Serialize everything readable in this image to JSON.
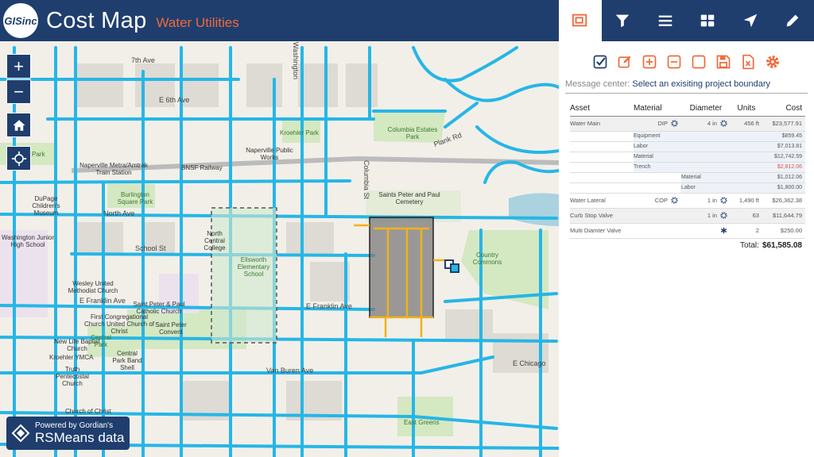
{
  "header": {
    "logo_text": "GISinc",
    "title": "Cost Map",
    "subtitle": "Water Utilities"
  },
  "tabs": [
    {
      "icon": "project-boundary-icon",
      "active": true
    },
    {
      "icon": "filter-icon"
    },
    {
      "icon": "list-icon"
    },
    {
      "icon": "grid-icon"
    },
    {
      "icon": "navigate-icon"
    },
    {
      "icon": "edit-icon"
    }
  ],
  "toolbar": [
    "check-icon",
    "edit-icon",
    "add-icon",
    "remove-icon",
    "square-icon",
    "save-icon",
    "excel-icon",
    "settings-icon"
  ],
  "message": {
    "label": "Message center:",
    "text": "Select an exisiting project boundary"
  },
  "table": {
    "headers": [
      "Asset",
      "Material",
      "Diameter",
      "Units",
      "Cost"
    ],
    "rows": [
      {
        "asset": "Water Main",
        "material": "DIP",
        "diameter": "4 in",
        "units": "456 ft",
        "cost": "$23,577.91"
      },
      {
        "asset": "Water Lateral",
        "material": "COP",
        "diameter": "1 in",
        "units": "1,490 ft",
        "cost": "$26,362.38"
      },
      {
        "asset": "Curb Stop Valve",
        "material": "",
        "diameter": "1 in",
        "units": "63",
        "cost": "$11,644.79"
      },
      {
        "asset": "Multi Diamter Valve",
        "material": "",
        "diameter": "",
        "units": "2",
        "cost": "$250.00"
      }
    ],
    "breakdown": [
      {
        "label": "Equipment",
        "cost": "$859.45"
      },
      {
        "label": "Labor",
        "cost": "$7,013.81"
      },
      {
        "label": "Material",
        "cost": "$12,742.59"
      },
      {
        "label": "Trench",
        "cost": "$2,812.06"
      }
    ],
    "trench_breakdown": [
      {
        "label": "Material",
        "cost": "$1,012.06"
      },
      {
        "label": "Labor",
        "cost": "$1,800.00"
      }
    ],
    "total_label": "Total:",
    "total": "$61,585.08"
  },
  "map": {
    "labels": [
      "7th Ave",
      "E 6th Ave",
      "Kroehler Park",
      "Columbia Estates Park",
      "Naperville Public Works",
      "Naperville Metra/Amtrak Train Station",
      "BNSF Railway",
      "Burlington Square Park",
      "DuPage Children's Museum",
      "North Ave",
      "Saints Peter and Paul Cemetery",
      "Washington Junior High School",
      "North Central College",
      "Ellsworth Elementary School",
      "School St",
      "Country Commons",
      "Wesley United Methodist Church",
      "E Franklin Ave",
      "Saint Peter & Paul Catholic Church",
      "First Congregational Church United Church of Christ",
      "Saint Peter Convent",
      "New Life Baptist Church",
      "Central Park",
      "Kroehler YMCA",
      "Truth Pentecostal Church",
      "Central Park Band Shell",
      "Van Buren Ave",
      "E Chicago",
      "East Greens",
      "Park",
      "Washington",
      "Columbia St",
      "Plank Rd",
      "Church of Christ"
    ]
  },
  "map_controls": [
    "zoom-in-icon",
    "zoom-out-icon",
    "home-icon",
    "locate-icon"
  ],
  "attribution": {
    "line1": "Powered by Gordian's",
    "line2": "RSMeans data"
  },
  "colors": {
    "header": "#1f3e6e",
    "accent": "#f1683a",
    "pipe": "#26b6e6",
    "trench_cost": "#e2524a"
  }
}
